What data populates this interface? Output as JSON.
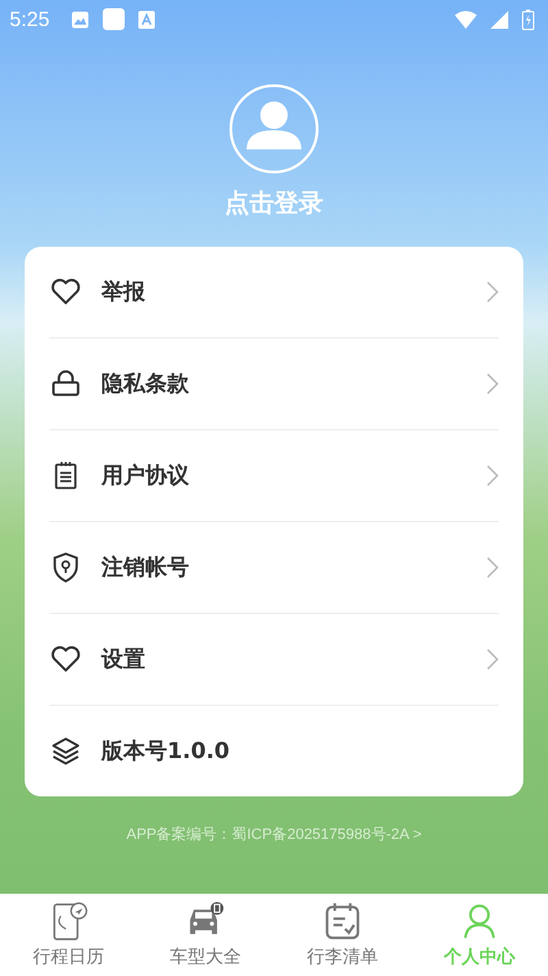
{
  "status_bar": {
    "time": "5:25"
  },
  "profile": {
    "login_label": "点击登录"
  },
  "menu": [
    {
      "label": "举报",
      "kind": "heart",
      "chevron": true
    },
    {
      "label": "隐私条款",
      "kind": "lock",
      "chevron": true
    },
    {
      "label": "用户协议",
      "kind": "notepad",
      "chevron": true
    },
    {
      "label": "注销帐号",
      "kind": "shield",
      "chevron": true
    },
    {
      "label": "设置",
      "kind": "heart",
      "chevron": true
    },
    {
      "label": "版本号1.0.0",
      "kind": "layers",
      "chevron": false
    }
  ],
  "footer": {
    "icp": "APP备案编号：蜀ICP备2025175988号-2A >"
  },
  "tabs": [
    {
      "label": "行程日历",
      "kind": "phone",
      "selected": false
    },
    {
      "label": "车型大全",
      "kind": "car",
      "selected": false
    },
    {
      "label": "行李清单",
      "kind": "calendar",
      "selected": false
    },
    {
      "label": "个人中心",
      "kind": "person",
      "selected": true
    }
  ]
}
